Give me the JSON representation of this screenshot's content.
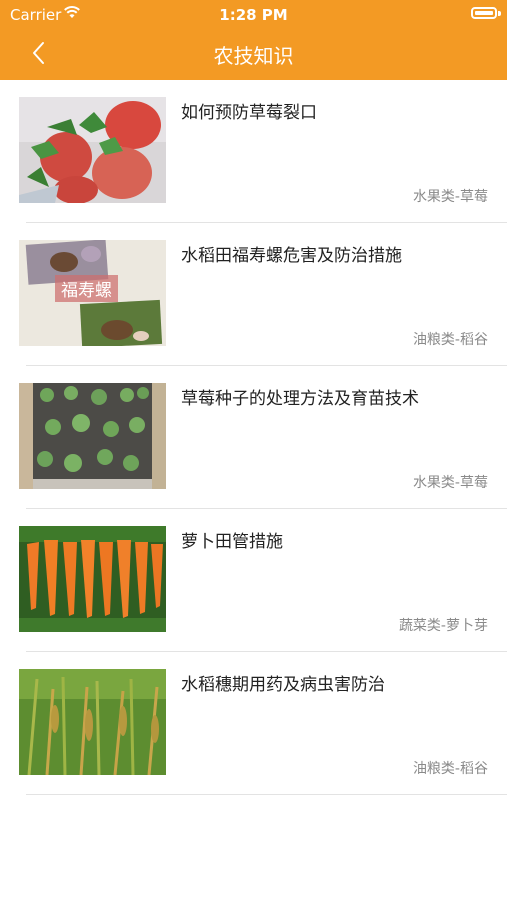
{
  "status_bar": {
    "carrier": "Carrier",
    "time": "1:28 PM"
  },
  "nav": {
    "title": "农技知识",
    "back_icon": "chevron-left-icon"
  },
  "colors": {
    "header_bg": "#f39a24",
    "title": "#222222",
    "category": "#8a8a8a"
  },
  "articles": [
    {
      "title": "如何预防草莓裂口",
      "category": "水果类-草莓",
      "thumb": "strawberry-photo"
    },
    {
      "title": "水稻田福寿螺危害及防治措施",
      "category": "油粮类-稻谷",
      "thumb": "snail-photo",
      "thumb_caption": "福寿螺"
    },
    {
      "title": "草莓种子的处理方法及育苗技术",
      "category": "水果类-草莓",
      "thumb": "seedling-photo"
    },
    {
      "title": "萝卜田管措施",
      "category": "蔬菜类-萝卜芽",
      "thumb": "carrot-photo"
    },
    {
      "title": "水稻穗期用药及病虫害防治",
      "category": "油粮类-稻谷",
      "thumb": "rice-photo"
    }
  ]
}
